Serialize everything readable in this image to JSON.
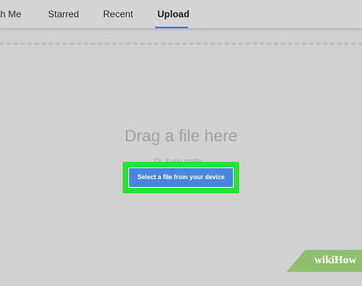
{
  "tabs": [
    {
      "label": "th Me"
    },
    {
      "label": "Starred"
    },
    {
      "label": "Recent"
    },
    {
      "label": "Upload",
      "active": true
    }
  ],
  "dropzone": {
    "title": "Drag a file here",
    "or_text": "Or, if you prefer...",
    "select_button": "Select a file from your device"
  },
  "watermark": {
    "text": "wikiHow"
  },
  "colors": {
    "accent": "#4a7bc8",
    "button": "#4a86e0",
    "highlight": "#24e52e",
    "watermark_bg": "#8fbf6e"
  }
}
